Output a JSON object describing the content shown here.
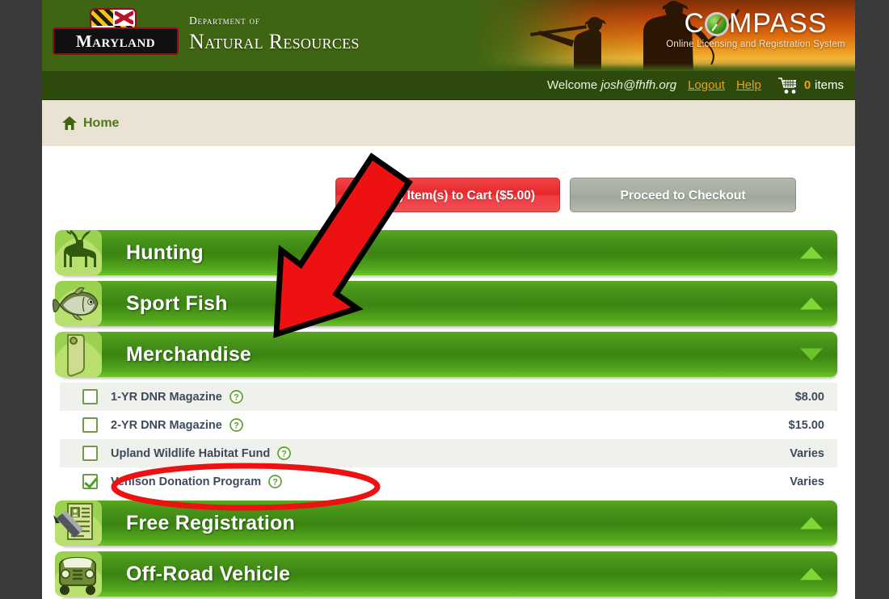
{
  "site": {
    "agency_small": "Department of",
    "agency_big": "Natural Resources",
    "state_logo_text": "Maryland",
    "compass_pre": "C",
    "compass_post": "MPASS",
    "compass_tagline": "Online Licensing and Registration System"
  },
  "userbar": {
    "welcome_prefix": "Welcome ",
    "username": "josh@fhfh.org",
    "logout_label": "Logout",
    "help_label": "Help",
    "cart_count": "0",
    "cart_units": "items",
    "cart_icon": "shopping-cart-icon"
  },
  "breadcrumb": {
    "home_label": "Home",
    "home_icon": "home-icon"
  },
  "toolbar": {
    "add_to_cart_label": "Add (1) Item(s) to Cart ($5.00)",
    "checkout_label": "Proceed to Checkout"
  },
  "categories": [
    {
      "label": "Hunting",
      "icon": "deer-icon",
      "state": "collapsed",
      "arrow": "triangle-up-icon"
    },
    {
      "label": "Sport Fish",
      "icon": "bass-fish-icon",
      "state": "collapsed",
      "arrow": "triangle-up-icon"
    },
    {
      "label": "Merchandise",
      "icon": "price-tag-icon",
      "state": "expanded",
      "arrow": "triangle-down-icon"
    },
    {
      "label": "Free Registration",
      "icon": "id-card-pencil-icon",
      "state": "collapsed",
      "arrow": "triangle-up-icon"
    },
    {
      "label": "Off-Road Vehicle",
      "icon": "jeep-icon",
      "state": "collapsed",
      "arrow": "triangle-up-icon"
    }
  ],
  "merchandise_items": [
    {
      "name": "1-YR DNR Magazine",
      "price": "$8.00",
      "checked": false,
      "help_icon": "help-circle-icon"
    },
    {
      "name": "2-YR DNR Magazine",
      "price": "$15.00",
      "checked": false,
      "help_icon": "help-circle-icon"
    },
    {
      "name": "Upland Wildlife Habitat Fund",
      "price": "Varies",
      "checked": false,
      "help_icon": "help-circle-icon"
    },
    {
      "name": "Venison Donation Program",
      "price": "Varies",
      "checked": true,
      "help_icon": "help-circle-icon"
    }
  ],
  "annotations": {
    "arrow": {
      "kind": "red-arrow-annotation",
      "points_to": "Merchandise"
    },
    "ellipse": {
      "kind": "red-ellipse-annotation",
      "surrounds": "Venison Donation Program"
    }
  },
  "colors": {
    "header_green": "#3f6412",
    "bar_green": "#3d8614",
    "accent_gold": "#e8a317",
    "add_button_red": "#e8262b",
    "checkout_button_gray": "#a6aca0",
    "breadcrumb_beige": "#eae3d4",
    "page_surround": "#3a3a3a",
    "annotation_red": "#ee1c1c"
  }
}
